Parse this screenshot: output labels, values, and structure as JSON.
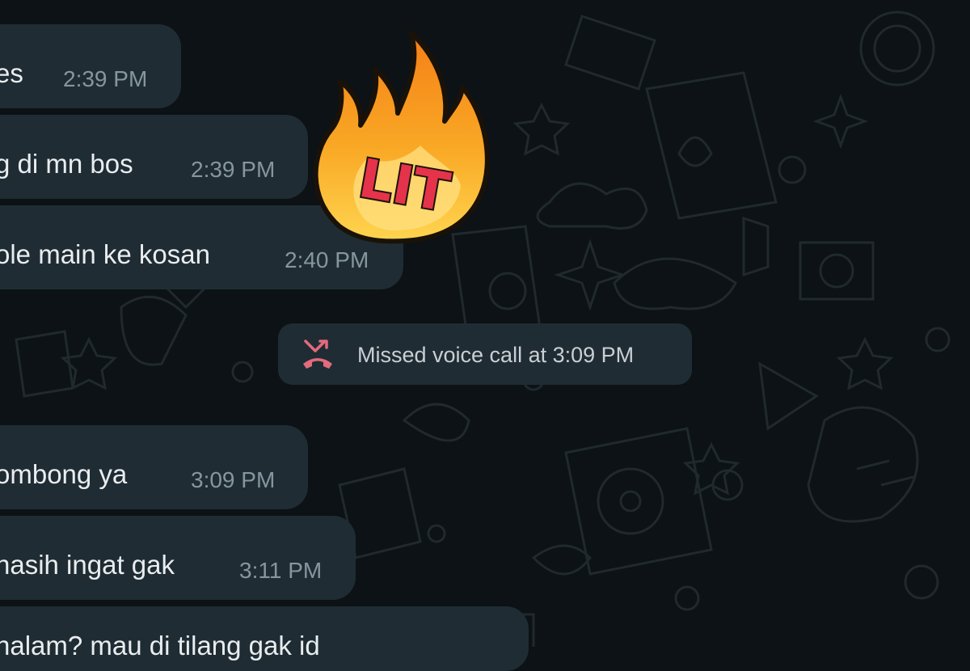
{
  "messages": [
    {
      "text": "es",
      "time": "2:39 PM"
    },
    {
      "text": "g di mn bos",
      "time": "2:39 PM"
    },
    {
      "text": "ole main ke kosan",
      "time": "2:40 PM"
    },
    {
      "text": "ombong ya",
      "time": "3:09 PM"
    },
    {
      "text": "nasih ingat gak",
      "time": "3:11 PM"
    },
    {
      "text": "nalam? mau di tilang gak id",
      "time": ""
    }
  ],
  "system_notice": {
    "text": "Missed voice call at 3:09 PM",
    "icon": "missed-call-icon",
    "icon_color": "#e26b7c"
  },
  "sticker": {
    "text": "LIT",
    "icon": "fire-lit-sticker",
    "flame_colors": [
      "#f9a825",
      "#ffd54f"
    ],
    "text_color": "#e5334b"
  },
  "colors": {
    "background": "#0c1215",
    "bubble": "#1f2c33",
    "text": "#e9edef",
    "time": "#8696a0"
  }
}
